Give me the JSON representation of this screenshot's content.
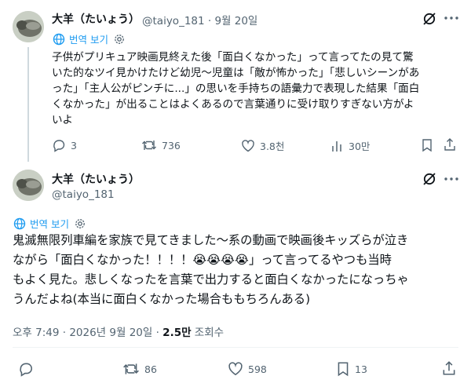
{
  "tweet1": {
    "name": "大羊（たいょう）",
    "handle_time": "@taiyo_181 · 9월 20일",
    "translate": "번역 보기",
    "lines": [
      "子供がプリキュア映画見終えた後「面白くなかった」って言ってたの見て驚",
      "いた的なツイ見かけたけど幼児〜児童は「敵が怖かった」「悲しいシーンがあ",
      "った」「主人公がピンチに...」の思いを手持ちの語彙力で表現した結果「面白",
      "くなかった」が出ることはよくあるので言葉通りに受け取りすぎない方がよ",
      "いよ"
    ],
    "replies": "3",
    "retweets": "736",
    "likes": "3.8천",
    "views": "30만"
  },
  "tweet2": {
    "name": "大羊（たいょう）",
    "handle": "@taiyo_181",
    "translate": "번역 보기",
    "lines": [
      "鬼滅無限列車編を家族で見てきました〜系の動画で映画後キッズらが泣き",
      "ながら「面白くなかった！！！！😭😭😭😭」って言ってるやつも当時",
      "もよく見た。悲しくなったを言葉で出力すると面白くなかったになっちゃ",
      "うんだよね(本当に面白くなかった場合ももちろんある)"
    ],
    "time": "오후 7:49 · 2026년 9월 20일 · ",
    "views_count": "2.5만",
    "views_label": " 조회수",
    "retweets": "86",
    "likes": "598",
    "bookmarks": "13"
  }
}
